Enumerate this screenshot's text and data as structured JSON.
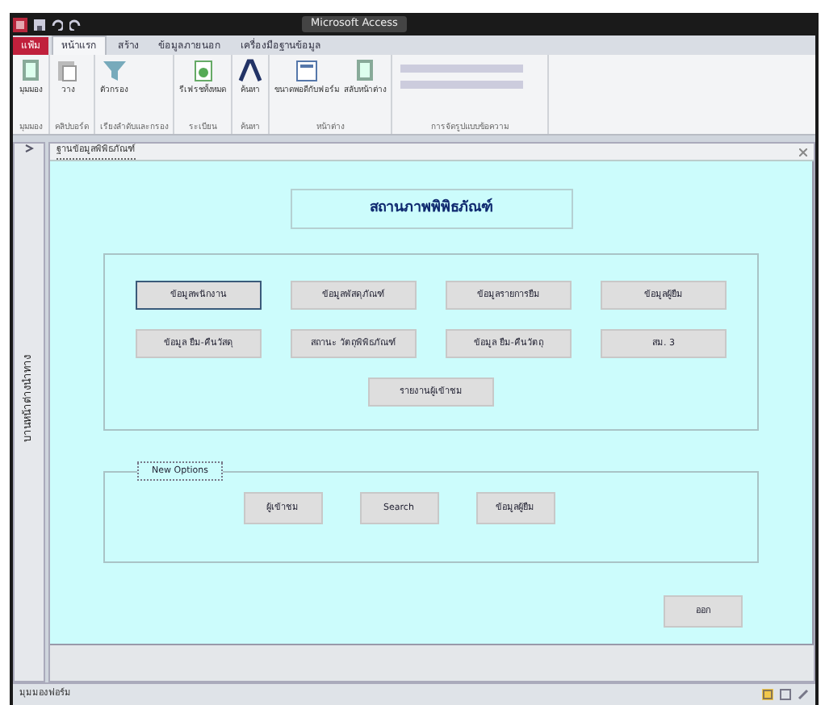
{
  "window": {
    "title": "Microsoft Access"
  },
  "tabs": [
    {
      "label": "แฟ้ม",
      "kind": "file",
      "selected": false
    },
    {
      "label": "หน้าแรก",
      "kind": "tab",
      "selected": true
    },
    {
      "label": "สร้าง",
      "kind": "tab",
      "selected": false
    },
    {
      "label": "ข้อมูลภายนอก",
      "kind": "tab",
      "selected": false
    },
    {
      "label": "เครื่องมือฐานข้อมูล",
      "kind": "tab",
      "selected": false
    }
  ],
  "ribbon": [
    {
      "label": "มุมมอง",
      "buttons": [
        "มุมมอง"
      ]
    },
    {
      "label": "คลิปบอร์ด",
      "buttons": [
        "วาง"
      ]
    },
    {
      "label": "เรียงลำดับและกรอง",
      "buttons": [
        "ตัวกรอง"
      ]
    },
    {
      "label": "ระเบียน",
      "buttons": [
        "รีเฟรชทั้งหมด"
      ]
    },
    {
      "label": "ค้นหา",
      "buttons": [
        "ค้นหา"
      ]
    },
    {
      "label": "หน้าต่าง",
      "buttons": [
        "ขนาดพอดีกับฟอร์ม",
        "สลับหน้าต่าง"
      ]
    },
    {
      "label": "การจัดรูปแบบข้อความ"
    }
  ],
  "nav_pane": {
    "title": "บานหน้าต่างนำทาง"
  },
  "document_tab": {
    "title": "ฐานข้อมูลพิพิธภัณฑ์"
  },
  "form": {
    "title": "สถานภาพพิพิธภัณฑ์",
    "main_buttons": [
      [
        {
          "label": "ข้อมูลพนักงาน",
          "focused": true
        },
        {
          "label": "ข้อมูลพัสดุภัณฑ์",
          "focused": false
        },
        {
          "label": "ข้อมูลรายการยืม",
          "focused": false
        },
        {
          "label": "ข้อมูลผู้ยืม",
          "focused": false
        }
      ],
      [
        {
          "label": "ข้อมูล ยืม-คืนวัสดุ",
          "focused": false
        },
        {
          "label": "สถานะ วัตถุพิพิธภัณฑ์",
          "focused": false
        },
        {
          "label": "ข้อมูล ยืม-คืนวัตถุ",
          "focused": false
        },
        {
          "label": "สม. 3",
          "focused": false
        }
      ],
      [
        {
          "label": "รายงานผู้เข้าชม",
          "focused": false
        }
      ]
    ],
    "new_options": {
      "legend": "New Options",
      "buttons": [
        "ผู้เข้าชม",
        "Search",
        "ข้อมูลผู้ยืม"
      ]
    },
    "exit_button": "ออก"
  },
  "status_bar": {
    "text": "มุมมองฟอร์ม"
  }
}
